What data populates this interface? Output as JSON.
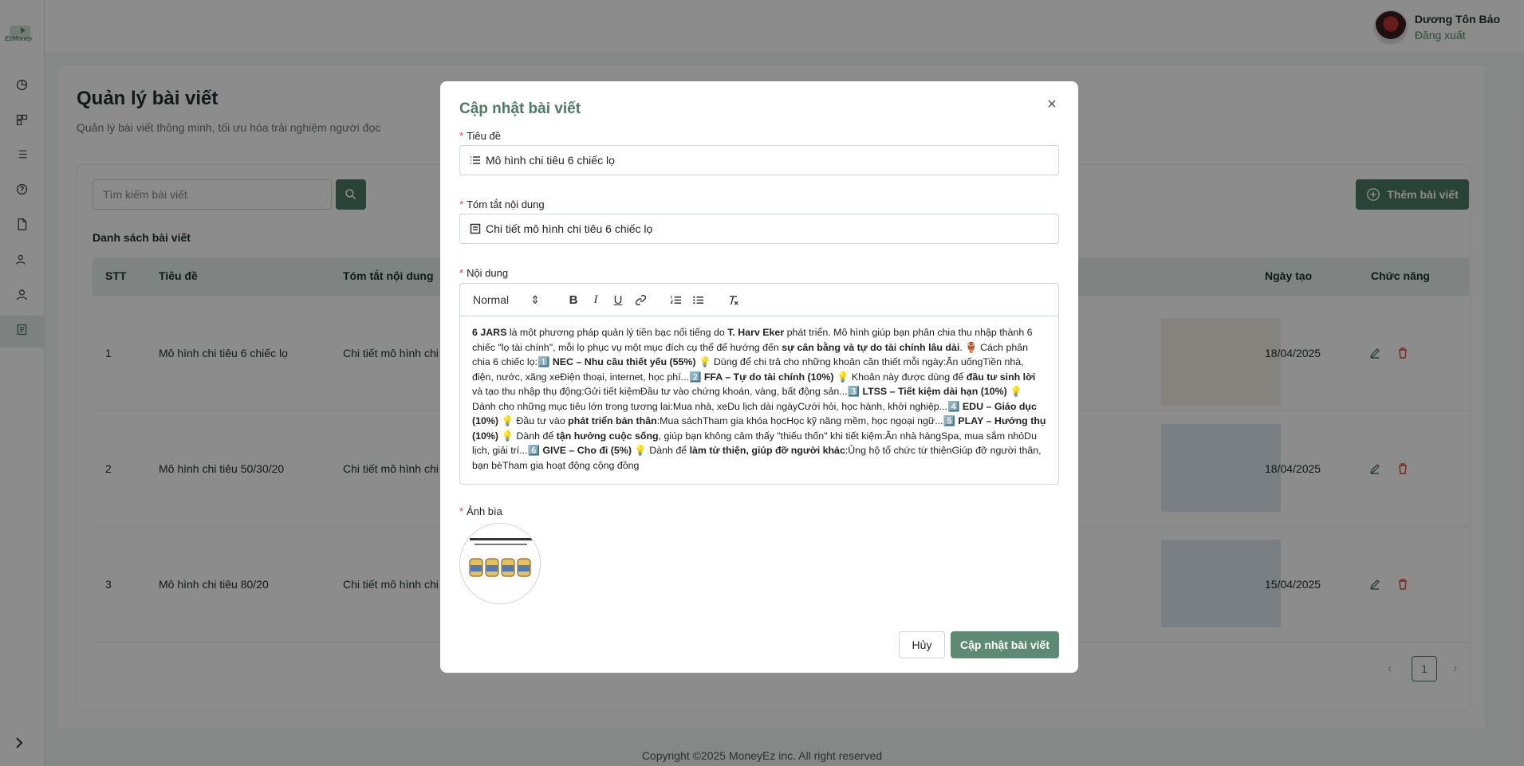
{
  "app": {
    "logo_text": "EzMoney"
  },
  "user": {
    "name": "Dương Tôn Bảo",
    "logout": "Đăng xuất"
  },
  "page": {
    "title": "Quản lý bài viết",
    "subtitle": "Quản lý bài viết thông minh, tối ưu hóa trải nghiệm người đọc"
  },
  "toolbar": {
    "search_placeholder": "Tìm kiếm bài viết",
    "add_label": "Thêm bài viết"
  },
  "list": {
    "title": "Danh sách bài viết"
  },
  "table": {
    "headers": {
      "stt": "STT",
      "title": "Tiêu đề",
      "summary": "Tóm tắt nội dung",
      "created": "Ngày tạo",
      "actions": "Chức năng"
    },
    "rows": [
      {
        "stt": "1",
        "title": "Mô hình chi tiêu 6 chiếc lọ",
        "summary": "Chi tiết mô hình chi",
        "created": "18/04/2025"
      },
      {
        "stt": "2",
        "title": "Mô hình chi tiêu 50/30/20",
        "summary": "Chi tiết mô hình chi",
        "created": "18/04/2025"
      },
      {
        "stt": "3",
        "title": "Mô hình chi tiêu 80/20",
        "summary": "Chi tiết mô hình chi",
        "created": "15/04/2025"
      }
    ]
  },
  "pagination": {
    "current": "1",
    "prev": "‹",
    "next": "›"
  },
  "footer": {
    "text": "Copyright ©2025 MoneyEz inc. All right reserved"
  },
  "modal": {
    "title": "Cập nhật bài viết",
    "close": "×",
    "fields": {
      "title_label": "Tiêu đề",
      "title_value": "Mô hình chi tiêu 6 chiếc lọ",
      "summary_label": "Tóm tắt nội dung",
      "summary_value": "Chi tiết mô hình chi tiêu 6 chiếc lọ",
      "content_label": "Nội dung",
      "cover_label": "Ảnh bìa"
    },
    "editor": {
      "format_select": "Normal",
      "segments": [
        {
          "t": "6 JARS",
          "b": true
        },
        {
          "t": " là một phương pháp quản lý tiền bạc nổi tiếng do ",
          "b": false
        },
        {
          "t": "T. Harv Eker",
          "b": true
        },
        {
          "t": " phát triển. Mô hình giúp bạn phân chia thu nhập thành 6 chiếc \"lọ tài chính\", mỗi lọ phục vụ một mục đích cụ thể để hướng đến ",
          "b": false
        },
        {
          "t": "sự cân bằng và tự do tài chính lâu dài",
          "b": true
        },
        {
          "t": ". 🏺 Cách phân chia 6 chiếc lọ:1️⃣ ",
          "b": false
        },
        {
          "t": "NEC – Nhu cầu thiết yếu (55%)",
          "b": true
        },
        {
          "t": " 💡 Dùng để chi trả cho những khoản cần thiết mỗi ngày:Ăn uốngTiền nhà, điện, nước, xăng xeĐiện thoại, internet, học phí...2️⃣ ",
          "b": false
        },
        {
          "t": "FFA – Tự do tài chính (10%)",
          "b": true
        },
        {
          "t": " 💡 Khoản này được dùng để ",
          "b": false
        },
        {
          "t": "đầu tư sinh lời",
          "b": true
        },
        {
          "t": " và tạo thu nhập thụ động:Gửi tiết kiệmĐầu tư vào chứng khoán, vàng, bất động sản...3️⃣ ",
          "b": false
        },
        {
          "t": "LTSS – Tiết kiệm dài hạn (10%)",
          "b": true
        },
        {
          "t": " 💡 Dành cho những mục tiêu lớn trong tương lai:Mua nhà, xeDu lịch dài ngàyCưới hỏi, học hành, khởi nghiệp...4️⃣ ",
          "b": false
        },
        {
          "t": "EDU – Giáo dục (10%)",
          "b": true
        },
        {
          "t": " 💡 Đầu tư vào ",
          "b": false
        },
        {
          "t": "phát triển bản thân",
          "b": true
        },
        {
          "t": ":Mua sáchTham gia khóa họcHọc kỹ năng mềm, học ngoại ngữ...5️⃣ ",
          "b": false
        },
        {
          "t": "PLAY – Hưởng thụ (10%)",
          "b": true
        },
        {
          "t": " 💡 Dành để ",
          "b": false
        },
        {
          "t": "tận hưởng cuộc sống",
          "b": true
        },
        {
          "t": ", giúp bạn không cảm thấy \"thiếu thốn\" khi tiết kiệm:Ăn nhà hàngSpa, mua sắm nhỏDu lịch, giải trí...6️⃣ ",
          "b": false
        },
        {
          "t": "GIVE – Cho đi (5%)",
          "b": true
        },
        {
          "t": " 💡 Dành để ",
          "b": false
        },
        {
          "t": "làm từ thiện, giúp đỡ người khác",
          "b": true
        },
        {
          "t": ":Ủng hộ tổ chức từ thiệnGiúp đỡ người thân, bạn bèTham gia hoạt động cộng đồng",
          "b": false
        }
      ]
    },
    "cancel_label": "Hủy",
    "submit_label": "Cập nhật bài viết"
  },
  "colors": {
    "brand": "#4e7a67",
    "danger": "#e0463d"
  }
}
